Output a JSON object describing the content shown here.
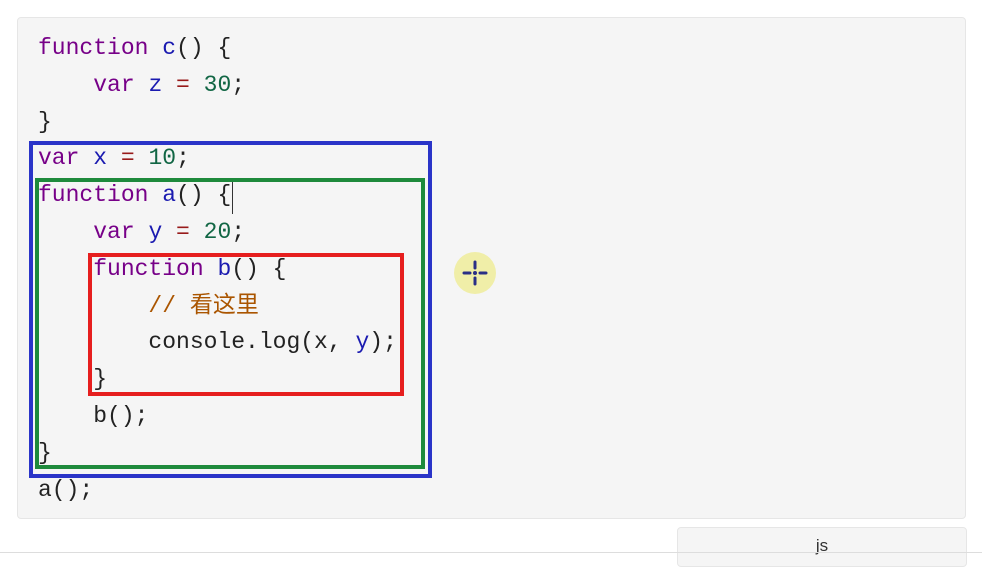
{
  "code": {
    "lines": [
      [
        {
          "t": "function ",
          "c": "kw"
        },
        {
          "t": "c",
          "c": "def"
        },
        {
          "t": "() {",
          "c": ""
        }
      ],
      [
        {
          "t": "    ",
          "c": ""
        },
        {
          "t": "var ",
          "c": "kw"
        },
        {
          "t": "z",
          "c": "def"
        },
        {
          "t": " = ",
          "c": "op"
        },
        {
          "t": "30",
          "c": "num"
        },
        {
          "t": ";",
          "c": ""
        }
      ],
      [
        {
          "t": "}",
          "c": ""
        }
      ],
      [
        {
          "t": "var ",
          "c": "kw"
        },
        {
          "t": "x",
          "c": "def"
        },
        {
          "t": " = ",
          "c": "op"
        },
        {
          "t": "10",
          "c": "num"
        },
        {
          "t": ";",
          "c": ""
        }
      ],
      [
        {
          "t": "function ",
          "c": "kw"
        },
        {
          "t": "a",
          "c": "def"
        },
        {
          "t": "() {",
          "c": ""
        }
      ],
      [
        {
          "t": "    ",
          "c": ""
        },
        {
          "t": "var ",
          "c": "kw"
        },
        {
          "t": "y",
          "c": "def"
        },
        {
          "t": " = ",
          "c": "op"
        },
        {
          "t": "20",
          "c": "num"
        },
        {
          "t": ";",
          "c": ""
        }
      ],
      [
        {
          "t": "    ",
          "c": ""
        },
        {
          "t": "function ",
          "c": "kw"
        },
        {
          "t": "b",
          "c": "def"
        },
        {
          "t": "() {",
          "c": ""
        }
      ],
      [
        {
          "t": "        ",
          "c": ""
        },
        {
          "t": "// 看这里",
          "c": "cm"
        }
      ],
      [
        {
          "t": "        console.log(x, ",
          "c": ""
        },
        {
          "t": "y",
          "c": "def"
        },
        {
          "t": ");",
          "c": ""
        }
      ],
      [
        {
          "t": "    }",
          "c": ""
        }
      ],
      [
        {
          "t": "    b();",
          "c": ""
        }
      ],
      [
        {
          "t": "}",
          "c": ""
        }
      ],
      [
        {
          "t": "a();",
          "c": ""
        }
      ]
    ]
  },
  "highlight_colors": {
    "outer": "#2a34c8",
    "middle": "#1e8a3c",
    "inner": "#e61e1e"
  },
  "cursor_icon": "crosshair-icon",
  "language_tab": {
    "label": "js"
  }
}
